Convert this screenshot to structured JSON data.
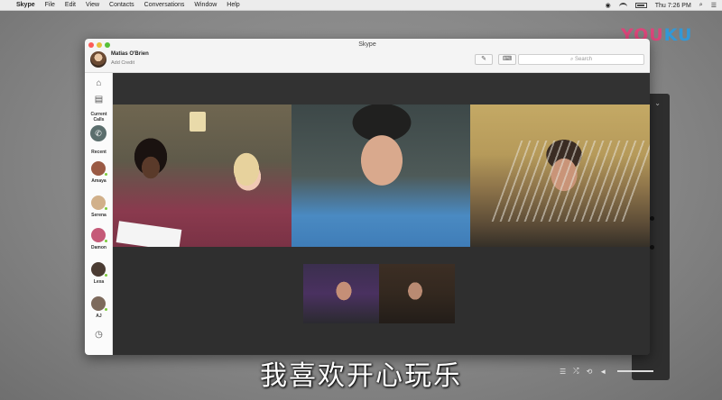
{
  "menubar": {
    "app": "Skype",
    "items": [
      "File",
      "Edit",
      "View",
      "Contacts",
      "Conversations",
      "Window",
      "Help"
    ],
    "clock": "Thu 7:26 PM",
    "icons": [
      "apple-icon",
      "wifi-icon",
      "battery-icon",
      "search-icon",
      "list-icon"
    ]
  },
  "watermark": {
    "part1": "YOU",
    "part2": "KU"
  },
  "window": {
    "title": "Skype",
    "user_name": "Matias O'Brien",
    "user_credit": "Add Credit",
    "search_placeholder": "Search",
    "toolbar_icons": [
      "compose-icon",
      "dialpad-icon"
    ]
  },
  "sidebar": {
    "home_icon": "home-icon",
    "contacts_icon": "contacts-book-icon",
    "current_calls_label": "Current\nCalls",
    "recent_label": "Recent",
    "contacts": [
      {
        "name": "Amaya",
        "color": "#9a5a44"
      },
      {
        "name": "Serena",
        "color": "#d1b08a"
      },
      {
        "name": "Damon",
        "color": "#c55a78"
      },
      {
        "name": "Lexa",
        "color": "#4b3c33"
      },
      {
        "name": "AJ",
        "color": "#7d6a5c"
      }
    ],
    "history_icon": "clock-icon"
  },
  "call": {
    "participants": 5,
    "presence_color": "#7ccb3c"
  },
  "subtitle": "我喜欢开心玩乐",
  "player": {
    "icons": [
      "playlist-icon",
      "shuffle-icon",
      "repeat-icon",
      "volume-icon"
    ]
  }
}
